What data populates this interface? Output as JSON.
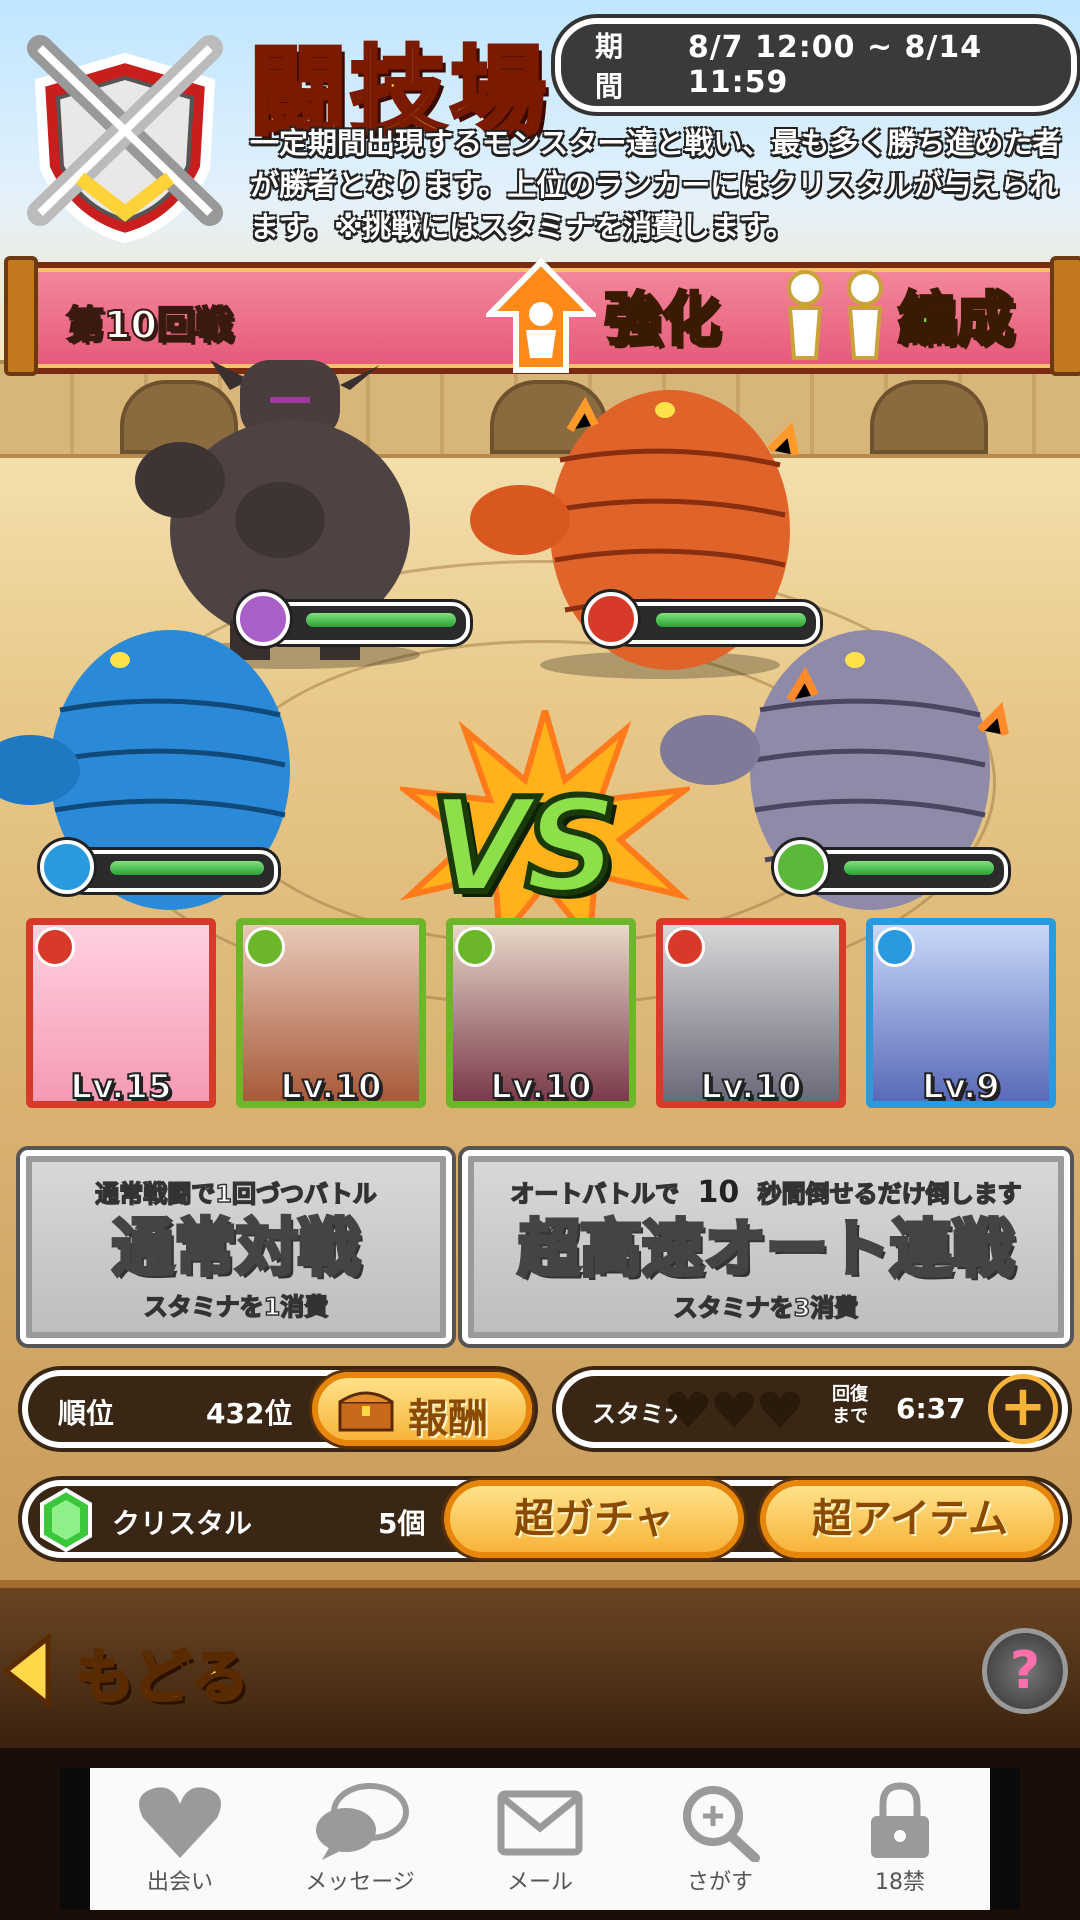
{
  "header": {
    "title": "闘技場",
    "period_label": "期間",
    "period_value": "8/7 12:00 ~ 8/14 11:59",
    "description": "一定期間出現するモンスター達と戦い、最も多く勝ち進めた者が勝者となります。上位のランカーにはクリスタルが与えられます。※挑戦にはスタミナを消費します。"
  },
  "round": {
    "label": "第10回戦",
    "power_up_label": "強化",
    "formation_label": "編成"
  },
  "enemies": [
    {
      "name": "dark-golem",
      "attribute": "eye",
      "hp_fraction": 1.0
    },
    {
      "name": "fire-mummy",
      "attribute": "fire",
      "hp_fraction": 1.0
    },
    {
      "name": "water-mummy",
      "attribute": "water",
      "hp_fraction": 1.0
    },
    {
      "name": "wood-mummy",
      "attribute": "wood",
      "hp_fraction": 1.0
    }
  ],
  "vs_label": "VS",
  "party": [
    {
      "level": "Lv.15",
      "attribute": "fire",
      "frame": "#d83a2a"
    },
    {
      "level": "Lv.10",
      "attribute": "wood",
      "frame": "#6cb62a"
    },
    {
      "level": "Lv.10",
      "attribute": "wood",
      "frame": "#6cb62a"
    },
    {
      "level": "Lv.10",
      "attribute": "fire",
      "frame": "#d83a2a"
    },
    {
      "level": "Lv.9",
      "attribute": "water",
      "frame": "#2a9ae0"
    }
  ],
  "battle": {
    "normal": {
      "top": "通常戦闘で1回づつバトル",
      "main": "通常対戦",
      "sub": "スタミナを1消費"
    },
    "auto": {
      "top_prefix": "オートバトルで",
      "seconds": "10",
      "top_suffix": "秒間倒せるだけ倒します",
      "main": "超高速オート連戦",
      "sub": "スタミナを3消費"
    }
  },
  "status": {
    "rank_label": "順位",
    "rank_value": "432位",
    "reward_label": "報酬",
    "stamina_label": "スタミナ",
    "stamina_hearts": 3,
    "recover_label": "回復まで",
    "recover_time": "6:37",
    "crystal_label": "クリスタル",
    "crystal_value": "5個",
    "super_gacha_label": "超ガチャ",
    "super_item_label": "超アイテム"
  },
  "nav": {
    "back_label": "もどる",
    "help_label": "?"
  },
  "tabbar": [
    {
      "label": "出会い",
      "icon": "heart-icon"
    },
    {
      "label": "メッセージ",
      "icon": "chat-bubble-icon"
    },
    {
      "label": "メール",
      "icon": "mail-icon"
    },
    {
      "label": "さがす",
      "icon": "search-icon"
    },
    {
      "label": "18禁",
      "icon": "lock-icon"
    }
  ],
  "colors": {
    "hp_green": "#2ba236",
    "banner_pink": "#e6597a",
    "gold": "#ffdd33"
  }
}
